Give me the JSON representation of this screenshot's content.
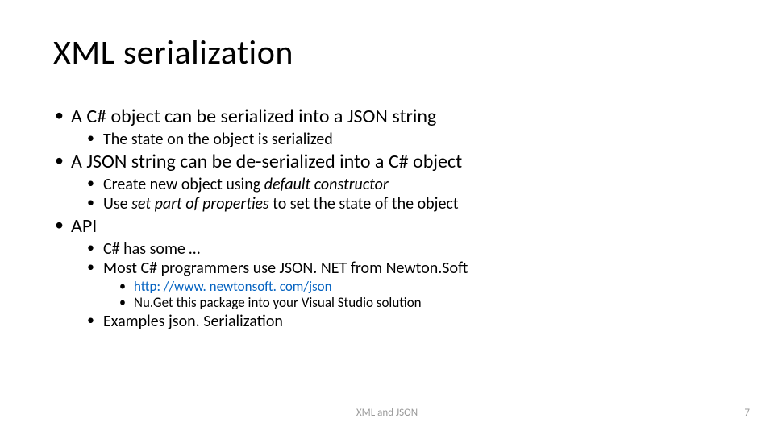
{
  "title": "XML serialization",
  "bullets": {
    "b1": "A C# object can be serialized into a JSON string",
    "b1_1": "The state on the object is serialized",
    "b2": "A JSON string can be de-serialized into a C# object",
    "b2_1_pre": "Create new object using ",
    "b2_1_em": "default constructor",
    "b2_2_pre": "Use ",
    "b2_2_em": "set part of properties",
    "b2_2_post": " to set the state of the object",
    "b3": "API",
    "b3_1": "C# has some …",
    "b3_2": "Most C# programmers use JSON. NET from Newton.Soft",
    "b3_2_1": "http: //www. newtonsoft. com/json",
    "b3_2_2": "Nu.Get this package into your Visual Studio solution",
    "b3_3": "Examples json. Serialization"
  },
  "footer": {
    "center": "XML and JSON",
    "page": "7"
  }
}
